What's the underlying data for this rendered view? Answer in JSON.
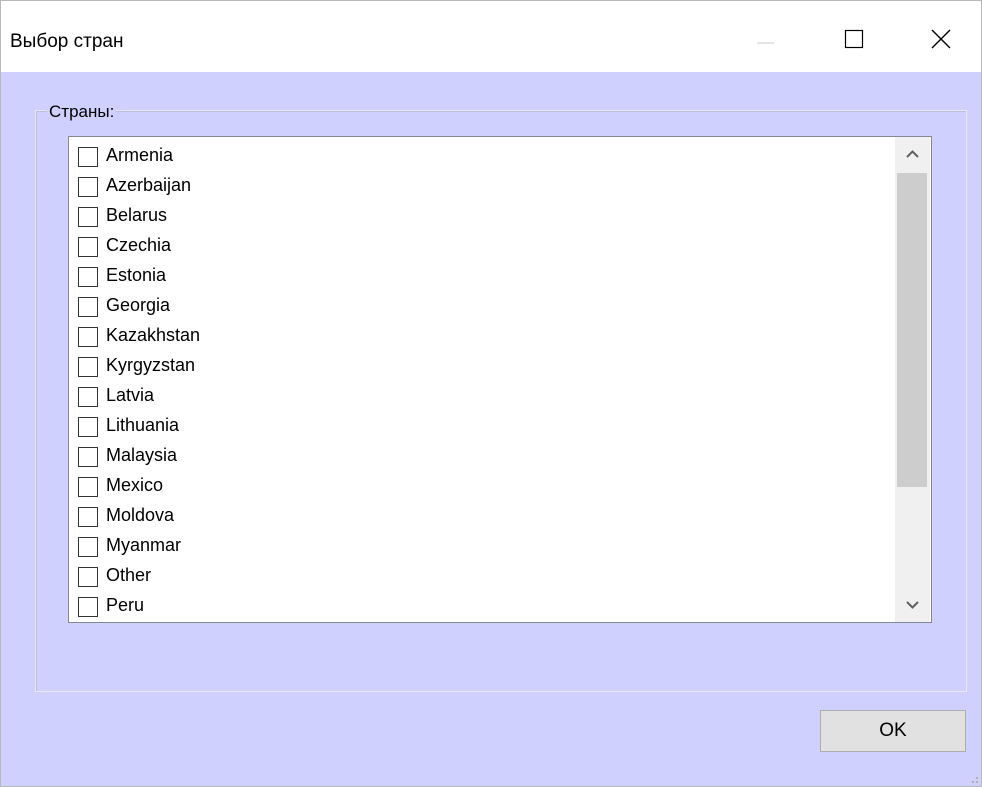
{
  "window": {
    "title": "Выбор стран"
  },
  "group": {
    "label": "Страны:"
  },
  "countries": [
    {
      "label": "Armenia",
      "checked": false
    },
    {
      "label": "Azerbaijan",
      "checked": false
    },
    {
      "label": "Belarus",
      "checked": false
    },
    {
      "label": "Czechia",
      "checked": false
    },
    {
      "label": "Estonia",
      "checked": false
    },
    {
      "label": "Georgia",
      "checked": false
    },
    {
      "label": "Kazakhstan",
      "checked": false
    },
    {
      "label": "Kyrgyzstan",
      "checked": false
    },
    {
      "label": "Latvia",
      "checked": false
    },
    {
      "label": "Lithuania",
      "checked": false
    },
    {
      "label": "Malaysia",
      "checked": false
    },
    {
      "label": "Mexico",
      "checked": false
    },
    {
      "label": "Moldova",
      "checked": false
    },
    {
      "label": "Myanmar",
      "checked": false
    },
    {
      "label": "Other",
      "checked": false
    },
    {
      "label": "Peru",
      "checked": false
    }
  ],
  "buttons": {
    "ok_label": "OK"
  },
  "icons": {
    "minimize": "minimize-icon",
    "maximize": "maximize-icon",
    "close": "close-icon",
    "scroll_up": "chevron-up-icon",
    "scroll_down": "chevron-down-icon"
  },
  "colors": {
    "client_background": "#d0d0ff",
    "titlebar_background": "#ffffff"
  }
}
